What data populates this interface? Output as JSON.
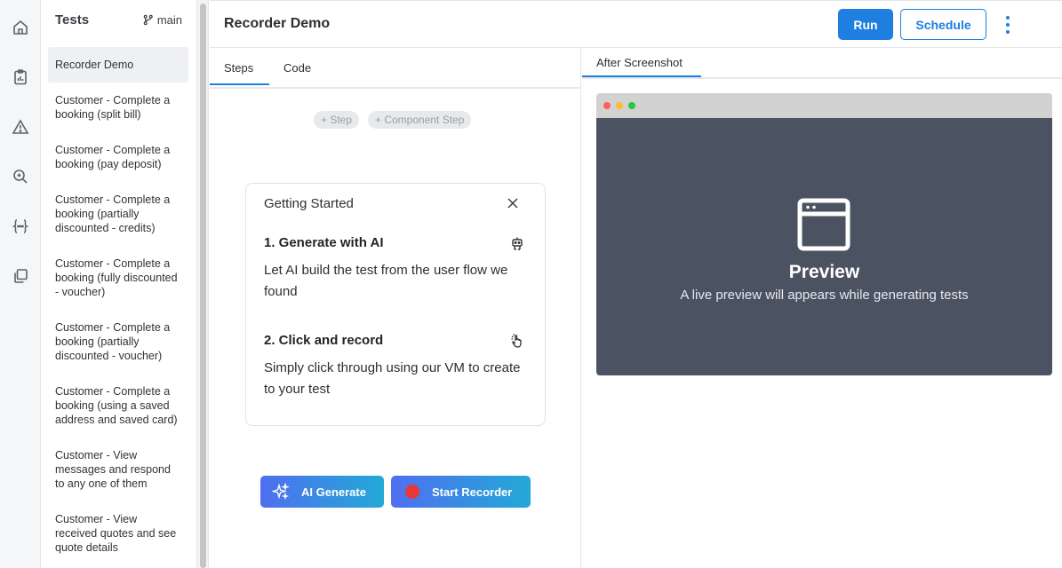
{
  "tests_panel": {
    "title": "Tests",
    "branch": "main",
    "items": [
      "Recorder Demo",
      "Customer - Complete a booking (split bill)",
      "Customer - Complete a booking (pay deposit)",
      "Customer - Complete a booking (partially discounted - credits)",
      "Customer - Complete a booking (fully discounted - voucher)",
      "Customer - Complete a booking (partially discounted - voucher)",
      "Customer - Complete a booking (using a saved address and saved card)",
      "Customer - View messages and respond to any one of them",
      "Customer - View received quotes and see quote details"
    ]
  },
  "header": {
    "title": "Recorder Demo",
    "run_label": "Run",
    "schedule_label": "Schedule"
  },
  "editor": {
    "tabs": [
      "Steps",
      "Code"
    ],
    "add_step": "+ Step",
    "add_component_step": "+ Component Step"
  },
  "getting_started": {
    "title": "Getting Started",
    "step1_title": "1. Generate with AI",
    "step1_text": "Let AI build the test from the user flow we found",
    "step2_title": "2. Click and record",
    "step2_text": "Simply click through using our VM to create to your test"
  },
  "actions": {
    "ai_generate": "AI Generate",
    "start_recorder": "Start Recorder"
  },
  "preview": {
    "tab": "After Screenshot",
    "title": "Preview",
    "subtitle": "A live preview will appears while generating tests"
  },
  "colors": {
    "accent": "#1f7fe0",
    "preview_bg": "#4b5362",
    "record": "#e53935"
  },
  "icons": {
    "rail": [
      "home-icon",
      "clipboard-chart-icon",
      "warning-icon",
      "search-bug-icon",
      "variables-icon",
      "copy-icon"
    ]
  }
}
